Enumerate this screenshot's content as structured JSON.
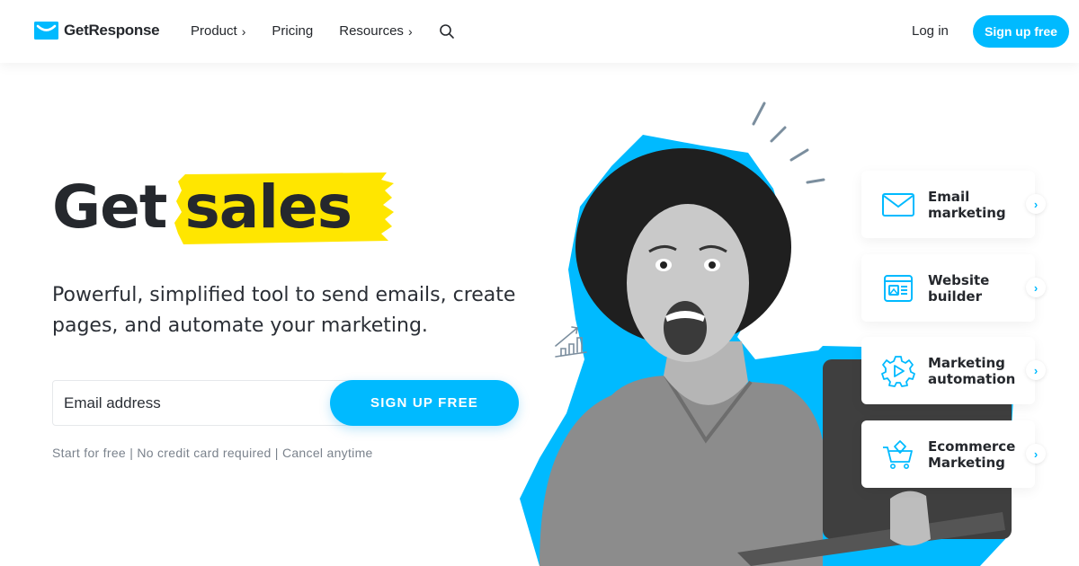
{
  "header": {
    "brand": "GetResponse",
    "nav": [
      {
        "label": "Product",
        "has_chevron": true,
        "chevron": "›"
      },
      {
        "label": "Pricing",
        "has_chevron": false
      },
      {
        "label": "Resources",
        "has_chevron": true,
        "chevron": "›"
      }
    ],
    "search_icon": "search-icon",
    "login_label": "Log in",
    "signup_label": "Sign up free"
  },
  "hero": {
    "title_plain": "Get",
    "title_highlight": "sales",
    "subtitle": "Powerful, simplified tool to send emails, create pages, and automate your marketing.",
    "email_placeholder": "Email address",
    "cta_label": "SIGN UP FREE",
    "fineprint": "Start for free | No credit card required | Cancel anytime"
  },
  "features": [
    {
      "label": "Email\nmarketing",
      "icon": "envelope-icon",
      "arrow": "›"
    },
    {
      "label": "Website\nbuilder",
      "icon": "website-builder-icon",
      "arrow": "›"
    },
    {
      "label": "Marketing\nautomation",
      "icon": "gear-play-icon",
      "arrow": "›"
    },
    {
      "label": "Ecommerce\nMarketing",
      "icon": "shopping-cart-icon",
      "arrow": "›"
    }
  ],
  "colors": {
    "brand": "#00baff",
    "highlight": "#ffe600",
    "text": "#25282d",
    "muted": "#7a828c"
  }
}
